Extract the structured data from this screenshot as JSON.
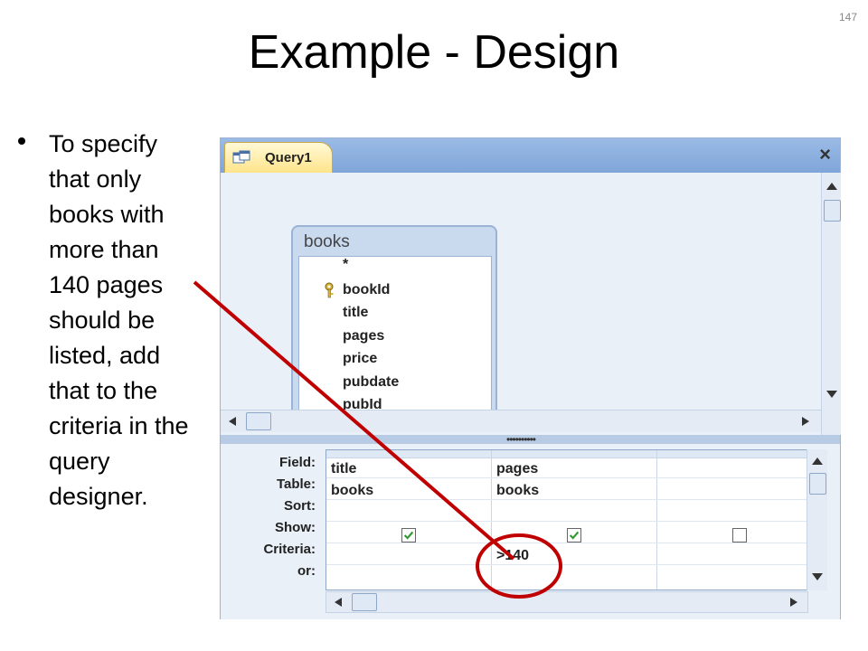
{
  "slide": {
    "number": "147",
    "title": "Example - Design",
    "bullet": "To specify that only books with more than 140 pages should be listed, add that to the criteria in the query designer."
  },
  "query_window": {
    "tab_label": "Query1",
    "close_glyph": "×",
    "table": {
      "name": "books",
      "fields": [
        "*",
        "bookId",
        "title",
        "pages",
        "price",
        "pubdate",
        "pubId"
      ],
      "primary_key": "bookId"
    },
    "grid": {
      "row_labels": [
        "Field:",
        "Table:",
        "Sort:",
        "Show:",
        "Criteria:",
        "or:"
      ],
      "columns": [
        {
          "field": "title",
          "table": "books",
          "sort": "",
          "show": true,
          "criteria": "",
          "or": ""
        },
        {
          "field": "pages",
          "table": "books",
          "sort": "",
          "show": true,
          "criteria": ">140",
          "or": ""
        },
        {
          "field": "",
          "table": "",
          "sort": "",
          "show": false,
          "criteria": "",
          "or": ""
        }
      ]
    }
  },
  "colors": {
    "annotation": "#c00000",
    "tab_bar": "#7fa5d8",
    "checkbox_check": "#2e9a2e"
  },
  "icons": [
    "bullet-dot",
    "query-icon",
    "close-icon",
    "key-icon",
    "scroll-up-icon",
    "scroll-down-icon",
    "scroll-left-icon",
    "scroll-right-icon",
    "checkbox-icon"
  ]
}
